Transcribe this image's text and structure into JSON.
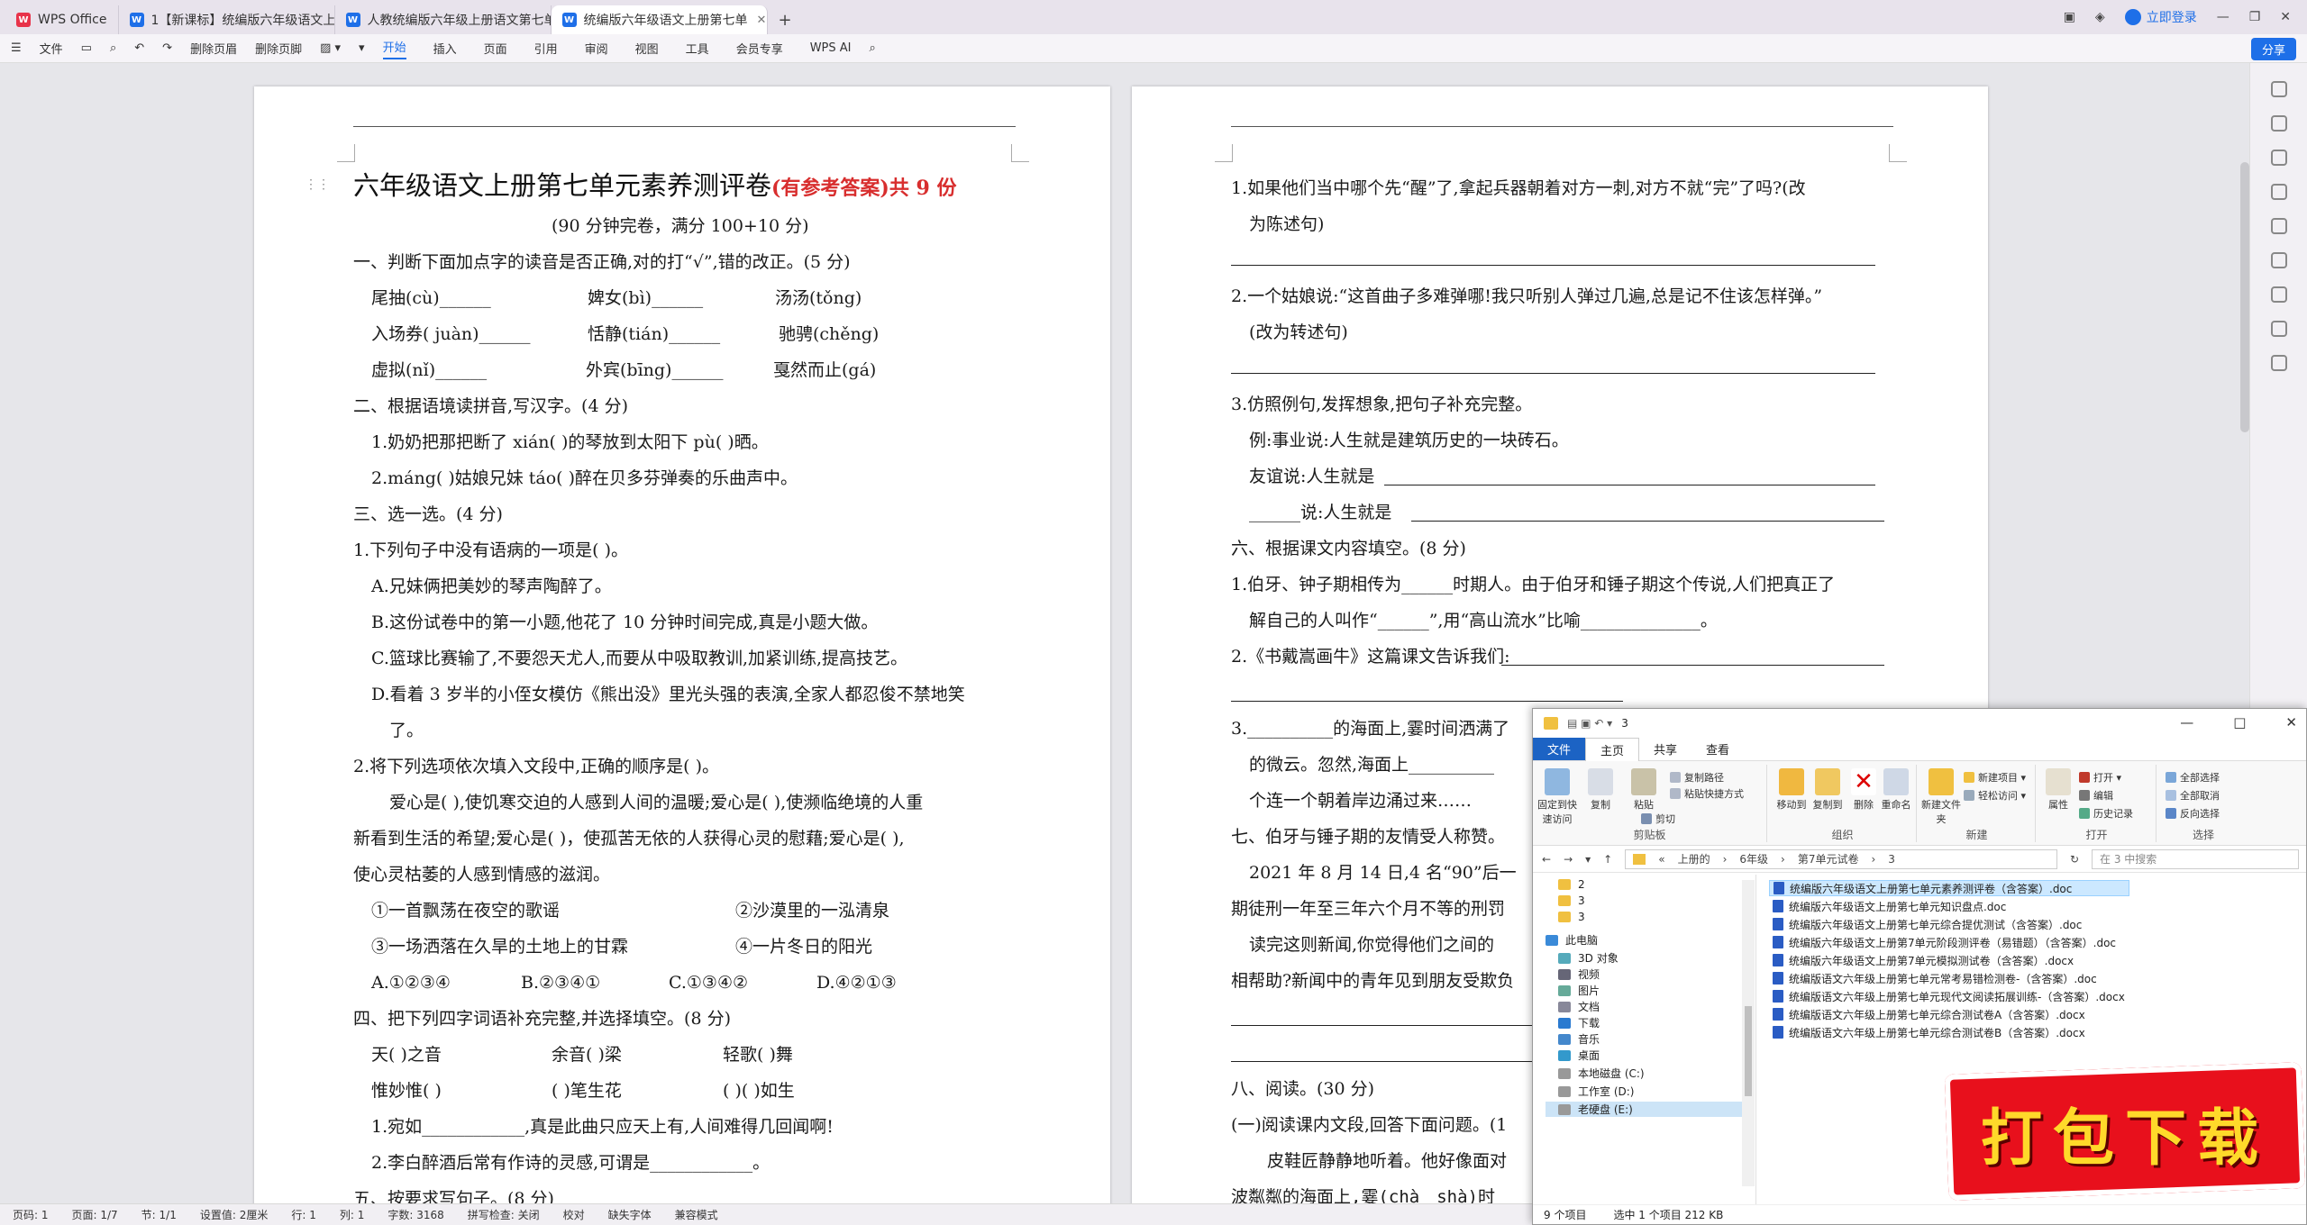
{
  "tabs": [
    {
      "label": "WPS Office",
      "icon": "wps-logo-icon"
    },
    {
      "label": "1【新课标】统编版六年级语文上册第",
      "icon": "word-doc-icon"
    },
    {
      "label": "人教统编版六年级上册语文第七单元",
      "icon": "word-doc-icon"
    },
    {
      "label": "统编版六年级语文上册第七单",
      "icon": "word-doc-icon",
      "active": true
    }
  ],
  "title_right": {
    "login": "立即登录"
  },
  "toolbar": {
    "file": "文件",
    "tools": [
      "删除页眉",
      "删除页脚"
    ],
    "menus": [
      "开始",
      "插入",
      "页面",
      "引用",
      "审阅",
      "视图",
      "工具",
      "会员专享"
    ],
    "active_menu": "开始",
    "wps_ai": "WPS AI",
    "share": "分享"
  },
  "page1": {
    "title": "六年级语文上册第七单元素养测评卷",
    "title_red": "(有参考答案)共 9 份",
    "subtitle": "(90 分钟完卷，满分 100+10 分)",
    "lines": [
      "一、判断下面加点字的读音是否正确,对的打“√”,错的改正。(5 分)",
      "尾抽(cù)______",
      "婢女(bì)______",
      "汤汤(tǒng)",
      "入场券( juàn)______",
      "恬静(tián)______",
      "驰骋(chěng)",
      "虚拟(nǐ)______",
      "外宾(bīng)______",
      "戛然而止(gá)",
      "二、根据语境读拼音,写汉字。(4 分)",
      "1.奶奶把那把断了 xián(          )的琴放到太阳下 pù(          )晒。",
      "2.máng(          )姑娘兄妹 táo(          )醉在贝多芬弹奏的乐曲声中。",
      "三、选一选。(4 分)",
      "1.下列句子中没有语病的一项是(          )。",
      "A.兄妹俩把美妙的琴声陶醉了。",
      "B.这份试卷中的第一小题,他花了 10 分钟时间完成,真是小题大做。",
      "C.篮球比赛输了,不要怨天尤人,而要从中吸取教训,加紧训练,提高技艺。",
      "D.看着 3 岁半的小侄女模仿《熊出没》里光头强的表演,全家人都忍俊不禁地笑",
      "了。",
      "2.将下列选项依次填入文段中,正确的顺序是(          )。",
      "爱心是(     ),使饥寒交迫的人感到人间的温暖;爱心是(     ),使濒临绝境的人重",
      "新看到生活的希望;爱心是(     )，使孤苦无依的人获得心灵的慰藉;爱心是(     ),",
      "使心灵枯萎的人感到情感的滋润。",
      "①一首飘荡在夜空的歌谣",
      "②沙漠里的一泓清泉",
      "③一场洒落在久旱的土地上的甘霖",
      "④一片冬日的阳光",
      "A.①②③④",
      "B.②③④①",
      "C.①③④②",
      "D.④②①③",
      "四、把下列四字词语补充完整,并选择填空。(8 分)",
      "天(      )之音",
      "余音(      )梁",
      "轻歌(      )舞",
      "惟妙惟(      )",
      "(      )笔生花",
      "(      )(      )如生",
      "1.宛如____________,真是此曲只应天上有,人间难得几回闻啊!",
      "2.李白醉酒后常有作诗的灵感,可谓是____________。",
      "五、按要求写句子。(8 分)"
    ]
  },
  "page2": {
    "lines": [
      "1.如果他们当中哪个先“醒”了,拿起兵器朝着对方一刺,对方不就“完”了吗?(改",
      "为陈述句)",
      "2.一个姑娘说:“这首曲子多难弹哪!我只听别人弹过几遍,总是记不住该怎样弹。”",
      "(改为转述句)",
      "3.仿照例句,发挥想象,把句子补充完整。",
      "例:事业说:人生就是建筑历史的一块砖石。",
      "友谊说:人生就是",
      "______说:人生就是",
      "六、根据课文内容填空。(8 分)",
      "1.伯牙、钟子期相传为______时期人。由于伯牙和锤子期这个传说,人们把真正了",
      "解自己的人叫作“______”,用“高山流水”比喻______________。",
      "2.《书戴嵩画牛》这篇课文告诉我们:",
      "3.__________的海面上,霎时间洒满了",
      "的微云。忽然,海面上__________",
      "个连一个朝着岸边涌过来……",
      "七、伯牙与锤子期的友情受人称赞。",
      "2021 年 8 月 14 日,4 名“90”后一",
      "期徒刑一年至三年六个月不等的刑罚",
      "读完这则新闻,你觉得他们之间的",
      "相帮助?新闻中的青年见到朋友受欺负",
      "八、阅读。(30 分)",
      "(一)阅读课内文段,回答下面问题。(1",
      "皮鞋匠静静地听着。他好像面对",
      "波粼粼的海面上,霎(chà　shà)时"
    ]
  },
  "status_bar": [
    "页码: 1",
    "页面: 1/7",
    "节: 1/1",
    "设置值: 2厘米",
    "行: 1",
    "列: 1",
    "字数: 3168",
    "拼写检查: 关闭",
    "校对",
    "缺失字体",
    "兼容模式"
  ],
  "explorer": {
    "title": "3",
    "window_controls": [
      "—",
      "□",
      "✕"
    ],
    "ribbon_tabs": [
      "文件",
      "主页",
      "共享",
      "查看"
    ],
    "groups": [
      "剪贴板",
      "组织",
      "新建",
      "打开",
      "选择"
    ],
    "clipboard": {
      "pin": "固定到快速访问",
      "copy": "复制",
      "paste": "粘贴",
      "cut": "剪切",
      "copy_path": "复制路径",
      "paste_shortcut": "粘贴快捷方式"
    },
    "organize": {
      "move_to": "移动到",
      "copy_to": "复制到",
      "delete": "删除",
      "rename": "重命名"
    },
    "new": {
      "new_folder": "新建文件夹",
      "new_item": "新建项目 ▾",
      "easy_access": "轻松访问 ▾"
    },
    "open": {
      "properties": "属性",
      "open": "打开 ▾",
      "edit": "编辑",
      "history": "历史记录"
    },
    "select": {
      "all": "全部选择",
      "none": "全部取消",
      "invert": "反向选择"
    },
    "path": [
      "上册的",
      "6年级",
      "第7单元试卷",
      "3"
    ],
    "search_placeholder": "在 3 中搜索",
    "nav_items": [
      "2",
      "3",
      "3",
      "此电脑",
      "3D 对象",
      "视频",
      "图片",
      "文档",
      "下载",
      "音乐",
      "桌面",
      "本地磁盘 (C:)",
      "工作室 (D:)",
      "老硬盘 (E:)"
    ],
    "files": [
      "统编版六年级语文上册第七单元素养测评卷（含答案）.doc",
      "统编版六年级语文上册第七单元知识盘点.doc",
      "统编版六年级语文上册第七单元综合提优测试（含答案）.doc",
      "统编版六年级语文上册第7单元阶段测评卷（易错题）（含答案）.doc",
      "统编版六年级语文上册第7单元模拟测试卷（含答案）.docx",
      "统编版语文六年级上册第七单元常考易错检测卷-（含答案）.doc",
      "统编版语文六年级上册第七单元现代文阅读拓展训练-（含答案）.docx",
      "统编版语文六年级上册第七单元综合测试卷A（含答案）.docx",
      "统编版语文六年级上册第七单元综合测试卷B（含答案）.docx"
    ],
    "status": {
      "count": "9 个项目",
      "selected": "选中 1 个项目  212 KB"
    }
  },
  "banner": {
    "text": "打包下载"
  }
}
